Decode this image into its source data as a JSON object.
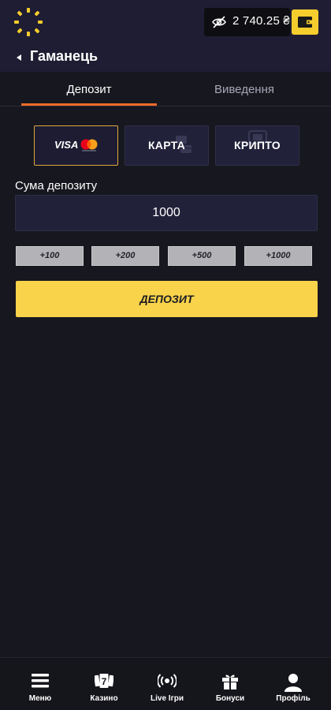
{
  "header": {
    "logo": "sunburst-logo",
    "balance": "2 740.25 ₴",
    "visibility_icon": "eye-off-icon",
    "wallet_icon": "wallet-icon",
    "accent_color": "#f5cd2d"
  },
  "title": {
    "back_icon": "caret-left-icon",
    "text": "Гаманець"
  },
  "tabs": [
    {
      "label": "Депозит",
      "active": true
    },
    {
      "label": "Виведення",
      "active": false
    }
  ],
  "payment_methods": [
    {
      "label_main": "VISA",
      "icon": "mastercard-icon",
      "active": true
    },
    {
      "label": "КАРТА",
      "active": false
    },
    {
      "label": "КРИПТО",
      "active": false
    }
  ],
  "amount": {
    "label": "Сума депозиту",
    "value": "1000"
  },
  "quick_amounts": [
    "+100",
    "+200",
    "+500",
    "+1000"
  ],
  "deposit_button": "ДЕПОЗИТ",
  "bottom_nav": [
    {
      "label": "Меню",
      "icon": "menu-icon"
    },
    {
      "label": "Казино",
      "icon": "slot-machine-icon"
    },
    {
      "label": "Live Ігри",
      "icon": "broadcast-icon"
    },
    {
      "label": "Бонуси",
      "icon": "gift-icon"
    },
    {
      "label": "Профіль",
      "icon": "user-icon"
    }
  ],
  "colors": {
    "background": "#17171f",
    "header": "#1f1d33",
    "tab_active_underline": "#ef6b2a",
    "deposit_button": "#f9d34a",
    "quick_button": "#b3b3b7"
  }
}
